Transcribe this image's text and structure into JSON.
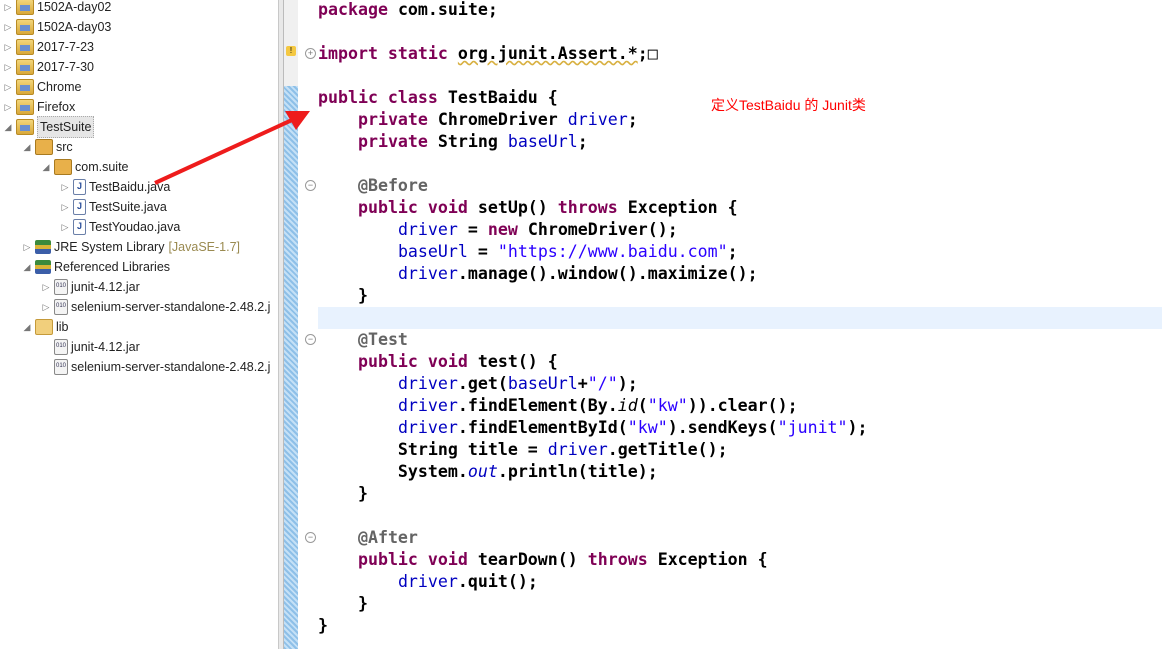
{
  "explorer": {
    "items": [
      {
        "label": "1502A-day02",
        "type": "proj",
        "level": 0,
        "twisty": "closed"
      },
      {
        "label": "1502A-day03",
        "type": "proj",
        "level": 0,
        "twisty": "closed"
      },
      {
        "label": "2017-7-23",
        "type": "proj",
        "level": 0,
        "twisty": "closed"
      },
      {
        "label": "2017-7-30",
        "type": "proj",
        "level": 0,
        "twisty": "closed"
      },
      {
        "label": "Chrome",
        "type": "proj",
        "level": 0,
        "twisty": "closed"
      },
      {
        "label": "Firefox",
        "type": "proj",
        "level": 0,
        "twisty": "closed"
      },
      {
        "label": "TestSuite",
        "type": "proj",
        "level": 0,
        "twisty": "open",
        "selected": true
      },
      {
        "label": "src",
        "type": "pkg",
        "level": 1,
        "twisty": "open"
      },
      {
        "label": "com.suite",
        "type": "pkg",
        "level": 2,
        "twisty": "open"
      },
      {
        "label": "TestBaidu.java",
        "type": "java",
        "level": 3,
        "twisty": "closed"
      },
      {
        "label": "TestSuite.java",
        "type": "java",
        "level": 3,
        "twisty": "closed"
      },
      {
        "label": "TestYoudao.java",
        "type": "java",
        "level": 3,
        "twisty": "closed"
      },
      {
        "label": "JRE System Library",
        "suffix": "[JavaSE-1.7]",
        "type": "lib",
        "level": 1,
        "twisty": "closed"
      },
      {
        "label": "Referenced Libraries",
        "type": "lib",
        "level": 1,
        "twisty": "open"
      },
      {
        "label": "junit-4.12.jar",
        "type": "jar",
        "level": 2,
        "twisty": "closed"
      },
      {
        "label": "selenium-server-standalone-2.48.2.j",
        "type": "jar",
        "level": 2,
        "twisty": "closed"
      },
      {
        "label": "lib",
        "type": "folder",
        "level": 1,
        "twisty": "open"
      },
      {
        "label": "junit-4.12.jar",
        "type": "jar",
        "level": 2,
        "twisty": "none"
      },
      {
        "label": "selenium-server-standalone-2.48.2.j",
        "type": "jar",
        "level": 2,
        "twisty": "none"
      }
    ]
  },
  "editor": {
    "lines": [
      [
        [
          "k",
          "package "
        ],
        [
          "",
          "com.suite;"
        ]
      ],
      [],
      [
        [
          "k",
          "import static "
        ],
        [
          "u",
          "org.junit.Assert.*"
        ],
        [
          "",
          ";"
        ],
        [
          "",
          "□"
        ]
      ],
      [],
      [
        [
          "k",
          "public class "
        ],
        [
          "",
          "TestBaidu {"
        ]
      ],
      [
        [
          "",
          "    "
        ],
        [
          "k",
          "private "
        ],
        [
          "",
          "ChromeDriver "
        ],
        [
          "f",
          "driver"
        ],
        [
          "",
          ";"
        ]
      ],
      [
        [
          "",
          "    "
        ],
        [
          "k",
          "private "
        ],
        [
          "",
          "String "
        ],
        [
          "f",
          "baseUrl"
        ],
        [
          "",
          ";"
        ]
      ],
      [],
      [
        [
          "",
          "    "
        ],
        [
          "a",
          "@Before"
        ]
      ],
      [
        [
          "",
          "    "
        ],
        [
          "k",
          "public void "
        ],
        [
          "",
          "setUp() "
        ],
        [
          "k",
          "throws "
        ],
        [
          "",
          "Exception {"
        ]
      ],
      [
        [
          "",
          "        "
        ],
        [
          "f",
          "driver"
        ],
        [
          "",
          " = "
        ],
        [
          "k",
          "new "
        ],
        [
          "",
          "ChromeDriver();"
        ]
      ],
      [
        [
          "",
          "        "
        ],
        [
          "f",
          "baseUrl"
        ],
        [
          "",
          " = "
        ],
        [
          "s",
          "\"https://www.baidu.com\""
        ],
        [
          "",
          ";"
        ]
      ],
      [
        [
          "",
          "        "
        ],
        [
          "f",
          "driver"
        ],
        [
          "",
          ".manage().window().maximize();"
        ]
      ],
      [
        [
          "",
          "    }"
        ]
      ],
      [],
      [
        [
          "",
          "    "
        ],
        [
          "a",
          "@Test"
        ]
      ],
      [
        [
          "",
          "    "
        ],
        [
          "k",
          "public void "
        ],
        [
          "",
          "test() {"
        ]
      ],
      [
        [
          "",
          "        "
        ],
        [
          "f",
          "driver"
        ],
        [
          "",
          ".get("
        ],
        [
          "f",
          "baseUrl"
        ],
        [
          "",
          "+"
        ],
        [
          "s",
          "\"/\""
        ],
        [
          "",
          ");"
        ]
      ],
      [
        [
          "",
          "        "
        ],
        [
          "f",
          "driver"
        ],
        [
          "",
          ".findElement(By."
        ],
        [
          "i",
          "id"
        ],
        [
          "",
          "("
        ],
        [
          "s",
          "\"kw\""
        ],
        [
          "",
          "))"
        ],
        [
          "",
          ".clear();"
        ]
      ],
      [
        [
          "",
          "        "
        ],
        [
          "f",
          "driver"
        ],
        [
          "",
          ".findElementById("
        ],
        [
          "s",
          "\"kw\""
        ],
        [
          "",
          ").sendKeys("
        ],
        [
          "s",
          "\"junit\""
        ],
        [
          "",
          ");"
        ]
      ],
      [
        [
          "",
          "        String title = "
        ],
        [
          "f",
          "driver"
        ],
        [
          "",
          ".getTitle();"
        ]
      ],
      [
        [
          "",
          "        System."
        ],
        [
          "fi",
          "out"
        ],
        [
          "",
          ".println(title);"
        ]
      ],
      [
        [
          "",
          "    }"
        ]
      ],
      [],
      [
        [
          "",
          "    "
        ],
        [
          "a",
          "@After"
        ]
      ],
      [
        [
          "",
          "    "
        ],
        [
          "k",
          "public void "
        ],
        [
          "",
          "tearDown() "
        ],
        [
          "k",
          "throws "
        ],
        [
          "",
          "Exception {"
        ]
      ],
      [
        [
          "",
          "        "
        ],
        [
          "f",
          "driver"
        ],
        [
          "",
          ".quit();"
        ]
      ],
      [
        [
          "",
          "    }"
        ]
      ],
      [
        [
          "",
          "}"
        ]
      ]
    ]
  },
  "annotation": {
    "text": "定义TestBaidu 的 Junit类",
    "color": "#ff0000"
  },
  "colors": {
    "keyword": "#7f0055",
    "field": "#0000c0",
    "string": "#2a00ff",
    "annotation": "#646464"
  }
}
